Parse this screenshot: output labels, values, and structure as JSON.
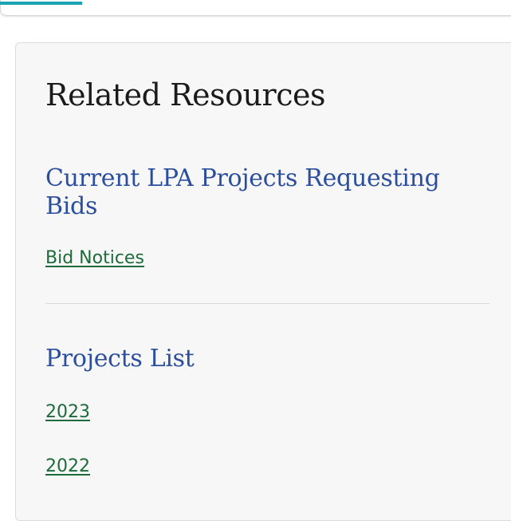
{
  "colors": {
    "accent_teal": "#1ba5b4",
    "heading_blue": "#2b4f9e",
    "link_green": "#1d6b3a",
    "card_background": "#f7f7f7"
  },
  "related_resources": {
    "title": "Related Resources",
    "sections": [
      {
        "heading": "Current LPA Projects Requesting Bids",
        "links": [
          "Bid Notices"
        ]
      },
      {
        "heading": "Projects List",
        "links": [
          "2023",
          "2022"
        ]
      }
    ]
  }
}
